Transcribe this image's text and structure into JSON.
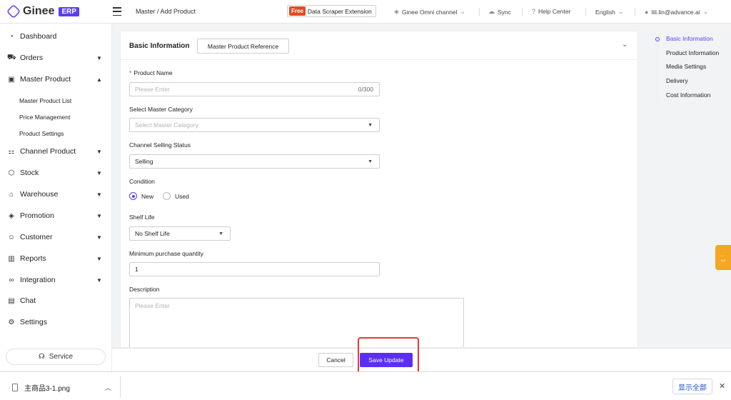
{
  "app": {
    "logo_text": "Ginee",
    "logo_badge": "ERP"
  },
  "topbar": {
    "breadcrumb": "Master / Add Product",
    "free_badge": "Free",
    "extension": "Data Scraper Extension",
    "omni_channel": "Ginee Omni channel",
    "sync": "Sync",
    "help_center": "Help Center",
    "language": "English",
    "user": "lili.lin@advance.ai"
  },
  "sidebar": {
    "items": [
      {
        "label": "Dashboard",
        "icon": "dashboard-icon"
      },
      {
        "label": "Orders",
        "icon": "cart-icon"
      },
      {
        "label": "Master Product",
        "icon": "bag-icon"
      },
      {
        "label": "Channel Product",
        "icon": "channel-icon"
      },
      {
        "label": "Stock",
        "icon": "box-icon"
      },
      {
        "label": "Warehouse",
        "icon": "warehouse-icon"
      },
      {
        "label": "Promotion",
        "icon": "tag-icon"
      },
      {
        "label": "Customer",
        "icon": "users-icon"
      },
      {
        "label": "Reports",
        "icon": "bar-chart-icon"
      },
      {
        "label": "Integration",
        "icon": "link-icon"
      },
      {
        "label": "Chat",
        "icon": "chat-icon"
      },
      {
        "label": "Settings",
        "icon": "gear-icon"
      }
    ],
    "sub_items": [
      "Master Product List",
      "Price Management",
      "Product Settings"
    ],
    "service": "Service"
  },
  "form": {
    "section_title": "Basic Information",
    "reference_button": "Master Product Reference",
    "product_name": {
      "label": "Product Name",
      "required": "*",
      "placeholder": "Please Enter",
      "counter": "0/300"
    },
    "category": {
      "label": "Select Master Category",
      "placeholder": "Select Master Category"
    },
    "selling_status": {
      "label": "Channel Selling Status",
      "value": "Selling"
    },
    "condition": {
      "label": "Condition",
      "options": [
        "New",
        "Used"
      ],
      "selected": "New"
    },
    "shelf_life": {
      "label": "Shelf Life",
      "value": "No Shelf Life"
    },
    "min_qty": {
      "label": "Minimum purchase quantity",
      "value": "1"
    },
    "description": {
      "label": "Description",
      "placeholder": "Please Enter"
    }
  },
  "actions": {
    "cancel": "Cancel",
    "save": "Save Update"
  },
  "anchors": [
    "Basic Information",
    "Product Information",
    "Media Settings",
    "Delivery",
    "Cost Information"
  ],
  "download_bar": {
    "file_name": "主商品3-1.png",
    "show_all": "显示全部"
  },
  "colors": {
    "accent": "#5b3df5",
    "save_button": "#5b2ef5",
    "highlight": "#e53935",
    "required": "#e5322e"
  }
}
